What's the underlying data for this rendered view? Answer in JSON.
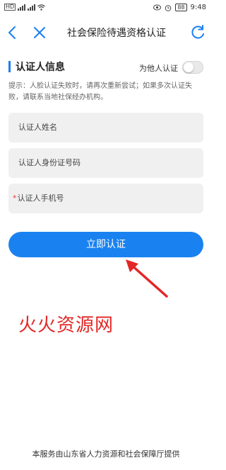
{
  "status_bar": {
    "left_sim": "HD",
    "time": "9:48",
    "battery": "88"
  },
  "nav": {
    "title": "社会保险待遇资格认证"
  },
  "section": {
    "title": "认证人信息",
    "proxy_label": "为他人认证",
    "proxy_enabled": false
  },
  "hint": "提示：人脸认证失败时，请再次重新尝试；如果多次认证失败，请联系当地社保经办机构。",
  "form": {
    "name_placeholder": "认证人姓名",
    "id_placeholder": "认证人身份证号码",
    "phone_required_mark": "*",
    "phone_placeholder": "认证人手机号"
  },
  "submit_label": "立即认证",
  "watermark": "火火资源网",
  "footer": "本服务由山东省人力资源和社会保障厅提供",
  "colors": {
    "accent": "#1a82f0",
    "watermark": "#e32626",
    "required": "#e53935"
  }
}
